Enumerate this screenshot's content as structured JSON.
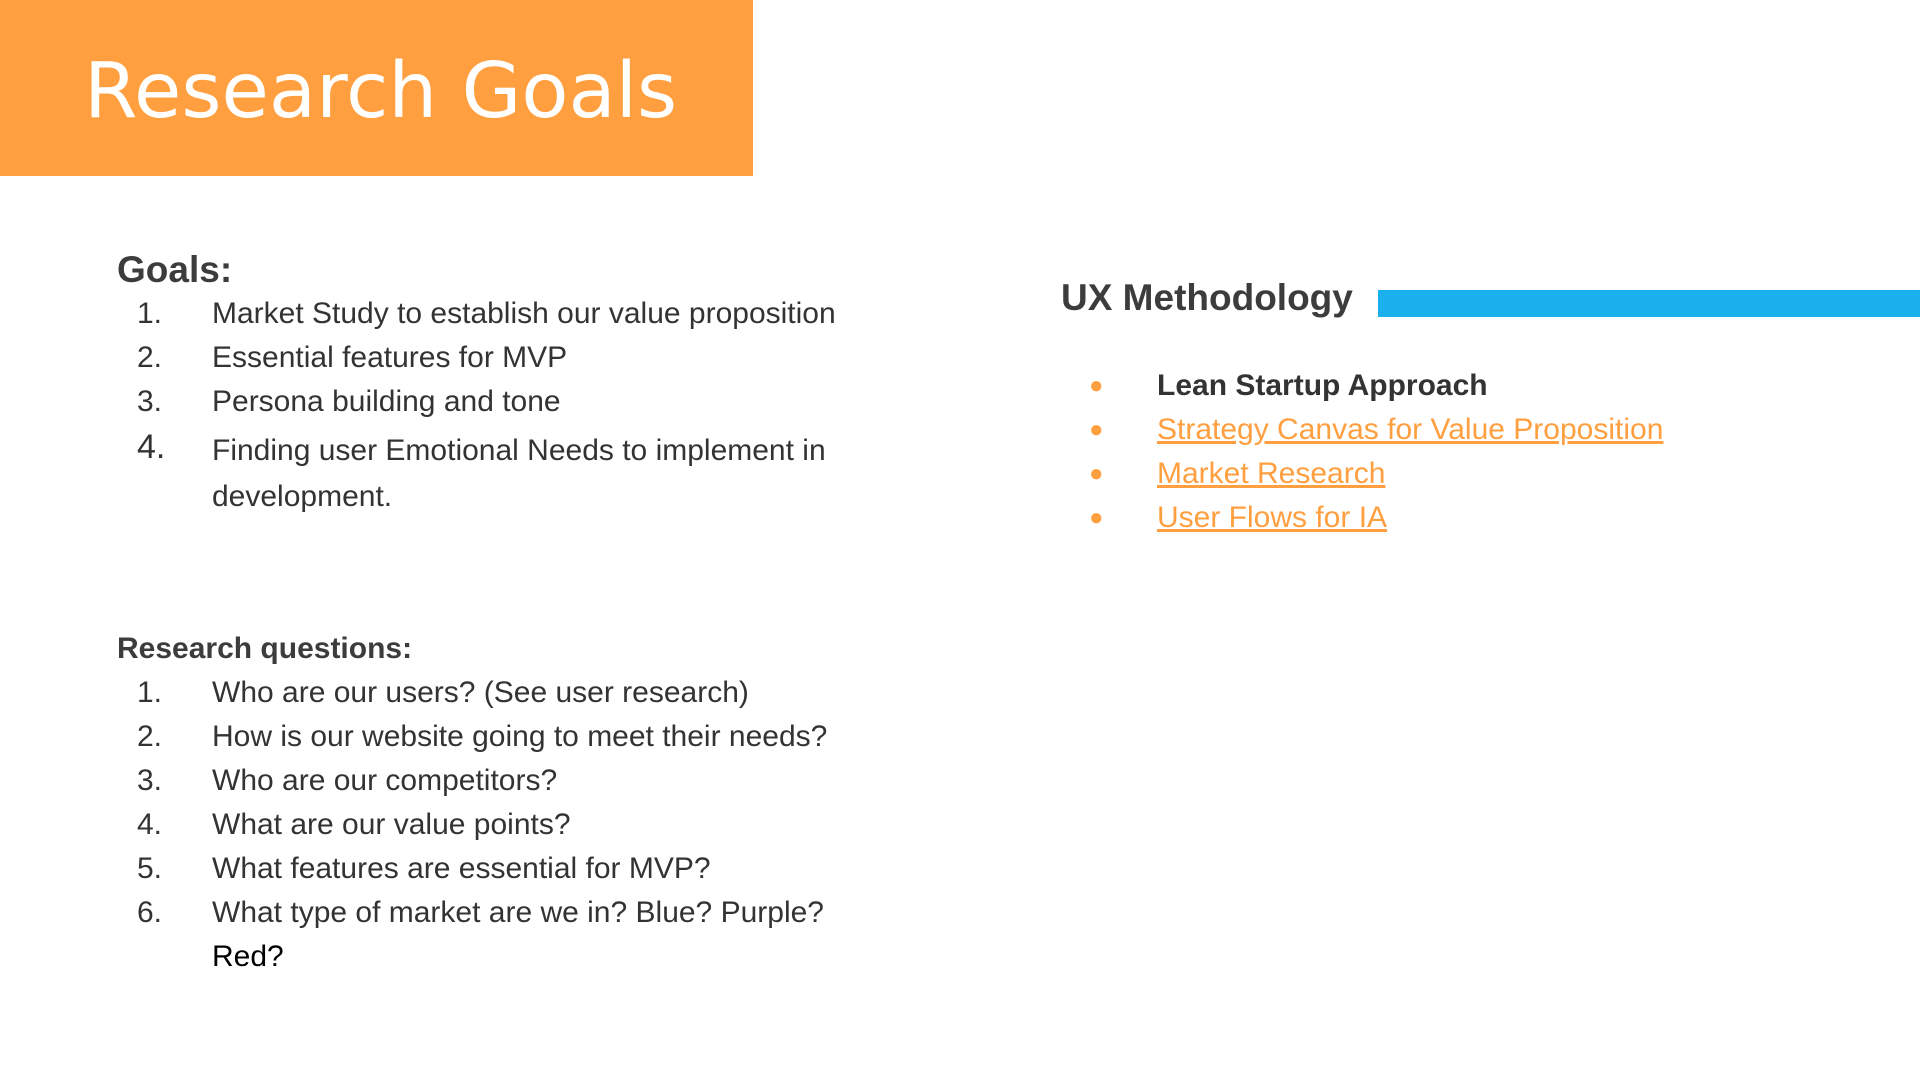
{
  "title": "Research Goals",
  "goals": {
    "heading": "Goals:",
    "items": [
      {
        "num": "1.",
        "text": "Market Study to establish our value proposition"
      },
      {
        "num": "2.",
        "text": "Essential features for MVP"
      },
      {
        "num": "3.",
        "text": "Persona building and tone"
      },
      {
        "num": "4.",
        "text": "Finding user Emotional Needs to implement in",
        "text2": "development."
      }
    ]
  },
  "research_questions": {
    "heading": "Research questions:",
    "items": [
      {
        "num": "1.",
        "text": "Who are our users? (See user research)"
      },
      {
        "num": "2.",
        "text": "How is our website going to meet their needs?"
      },
      {
        "num": "3.",
        "text": "Who are our competitors?"
      },
      {
        "num": "4.",
        "text": "What are our value points?"
      },
      {
        "num": "5.",
        "text": "What features are essential for MVP?"
      },
      {
        "num": "6.",
        "text": "What type of market are we in? Blue? Purple?",
        "text2": "Red?"
      }
    ]
  },
  "methodology": {
    "heading": "UX Methodology",
    "bullet": "●",
    "items": [
      {
        "text": "Lean Startup Approach",
        "link": false
      },
      {
        "text": "Strategy Canvas for Value Proposition",
        "link": true
      },
      {
        "text": "Market Research",
        "link": true
      },
      {
        "text": "User Flows for IA",
        "link": true
      }
    ]
  },
  "colors": {
    "accent_orange": "#ff9f3f",
    "accent_blue": "#1ab0ee",
    "text_dark": "#333333"
  }
}
